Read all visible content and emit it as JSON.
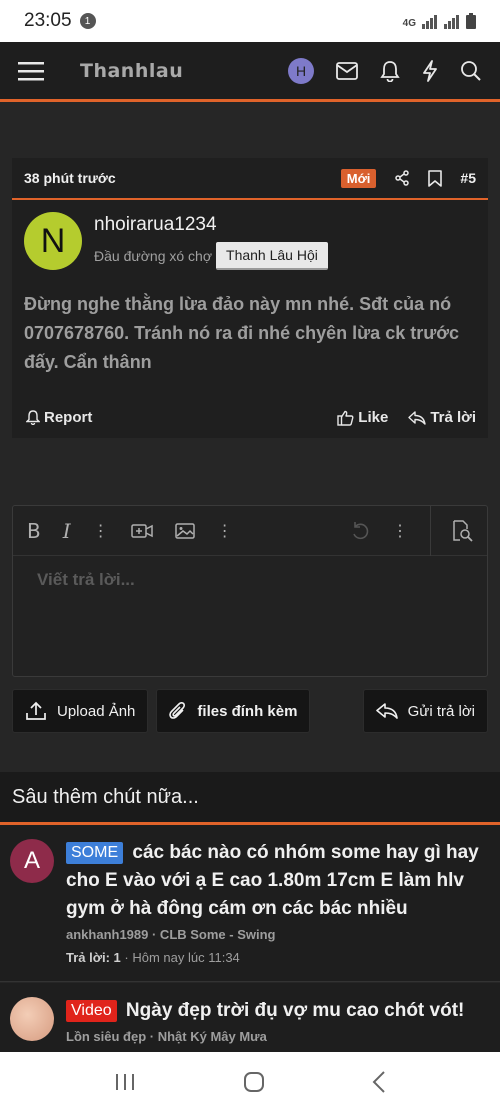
{
  "status_bar": {
    "time": "23:05",
    "notification_count": "1",
    "network": "4G"
  },
  "header": {
    "logo": "Thanhlau",
    "avatar_letter": "H"
  },
  "post": {
    "time": "38 phút trước",
    "badge": "Mới",
    "number": "#5",
    "avatar_letter": "N",
    "username": "nhoirarua1234",
    "user_title": "Đầu đường xó chợ",
    "user_tag": "Thanh Lâu Hội",
    "body": "Đừng nghe thằng lừa đảo này mn nhé. Sđt của nó 0707678760. Tránh nó ra đi nhé chyên lừa ck trước đấy. Cẩn thânn",
    "report_label": "Report",
    "like_label": "Like",
    "reply_label": "Trả lời"
  },
  "editor": {
    "placeholder": "Viết trả lời..."
  },
  "buttons": {
    "upload": "Upload Ảnh",
    "files": "files đính kèm",
    "send": "Gửi trả lời"
  },
  "section": {
    "title": "Sâu thêm chút nữa..."
  },
  "threads": [
    {
      "avatar_letter": "A",
      "avatar_color": "#8e2b4a",
      "prefix": "SOME",
      "title": "các bác nào có nhóm some hay gì hay cho E vào với ạ E cao 1.80m 17cm E làm hlv gym ở hà đông cám ơn các bác nhiều",
      "meta": "ankhanh1989 · CLB Some - Swing",
      "replies_label": "Trả lời:",
      "replies": "1",
      "time": "Hôm nay lúc 11:34"
    },
    {
      "avatar_letter": "",
      "avatar_color": "#e8b59a",
      "prefix": "Video",
      "title": "Ngày đẹp trời đụ vợ mu cao chót vót!",
      "meta": "Lồn siêu đẹp · Nhật Ký Mây Mưa"
    }
  ],
  "colors": {
    "accent": "#e0632a",
    "background": "#262626",
    "prefix_blue": "#3d7fd9",
    "prefix_red": "#e0241b"
  }
}
